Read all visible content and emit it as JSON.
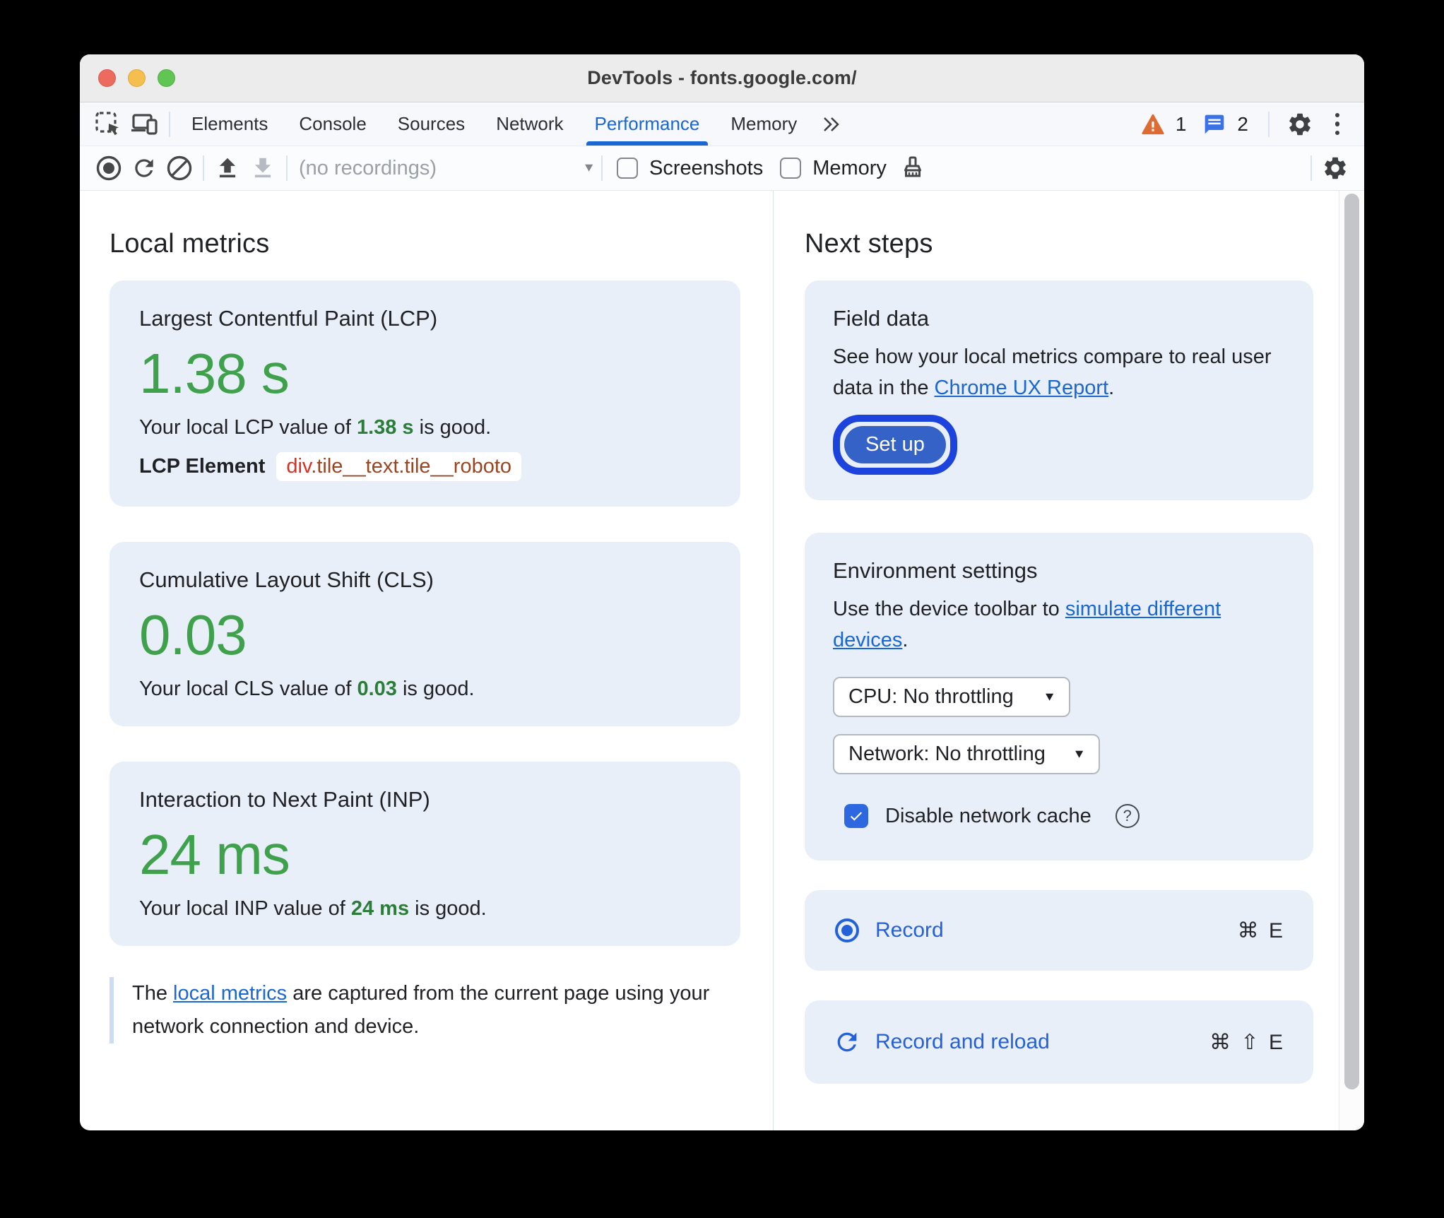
{
  "window": {
    "title": "DevTools - fonts.google.com/"
  },
  "tabs": {
    "items": [
      {
        "label": "Elements"
      },
      {
        "label": "Console"
      },
      {
        "label": "Sources"
      },
      {
        "label": "Network"
      },
      {
        "label": "Performance"
      },
      {
        "label": "Memory"
      }
    ],
    "warning_count": "1",
    "message_count": "2"
  },
  "toolbar": {
    "recordings_select": "(no recordings)",
    "screenshots_label": "Screenshots",
    "memory_label": "Memory"
  },
  "local_metrics": {
    "heading": "Local metrics",
    "cards": [
      {
        "title": "Largest Contentful Paint (LCP)",
        "value": "1.38 s",
        "desc_prefix": "Your local LCP value of ",
        "desc_value": "1.38 s",
        "desc_suffix": " is good.",
        "element_label": "LCP Element",
        "element_tag": "div",
        "element_classes": ".tile__text.tile__roboto"
      },
      {
        "title": "Cumulative Layout Shift (CLS)",
        "value": "0.03",
        "desc_prefix": "Your local CLS value of ",
        "desc_value": "0.03",
        "desc_suffix": " is good."
      },
      {
        "title": "Interaction to Next Paint (INP)",
        "value": "24 ms",
        "desc_prefix": "Your local INP value of ",
        "desc_value": "24 ms",
        "desc_suffix": " is good."
      }
    ],
    "footer": {
      "prefix": "The ",
      "link": "local metrics",
      "suffix": " are captured from the current page using your network connection and device."
    }
  },
  "next_steps": {
    "heading": "Next steps",
    "field_data": {
      "title": "Field data",
      "desc_prefix": "See how your local metrics compare to real user data in the ",
      "link": "Chrome UX Report",
      "desc_suffix": ".",
      "button_label": "Set up"
    },
    "environment": {
      "title": "Environment settings",
      "desc_prefix": "Use the device toolbar to ",
      "link": "simulate different devices",
      "desc_suffix": ".",
      "cpu_select": "CPU: No throttling",
      "network_select": "Network: No throttling",
      "cache_label": "Disable network cache"
    },
    "record": {
      "label": "Record",
      "shortcut": "⌘ E"
    },
    "record_reload": {
      "label": "Record and reload",
      "shortcut": "⌘ ⇧ E"
    }
  },
  "icons": {
    "dropdown_arrow": "▼",
    "help": "?"
  },
  "colors": {
    "accent_blue": "#1967d2",
    "good_green": "#3fa14c",
    "good_green_dark": "#2b7d39",
    "button_blue": "#3562c6",
    "focus_ring_blue": "#1d43dd",
    "warning_orange": "#dd6b32",
    "message_blue": "#3a72e8",
    "card_bg": "#e9eff9",
    "element_tag_red": "#d93025",
    "element_class_brown": "#9a4522"
  }
}
